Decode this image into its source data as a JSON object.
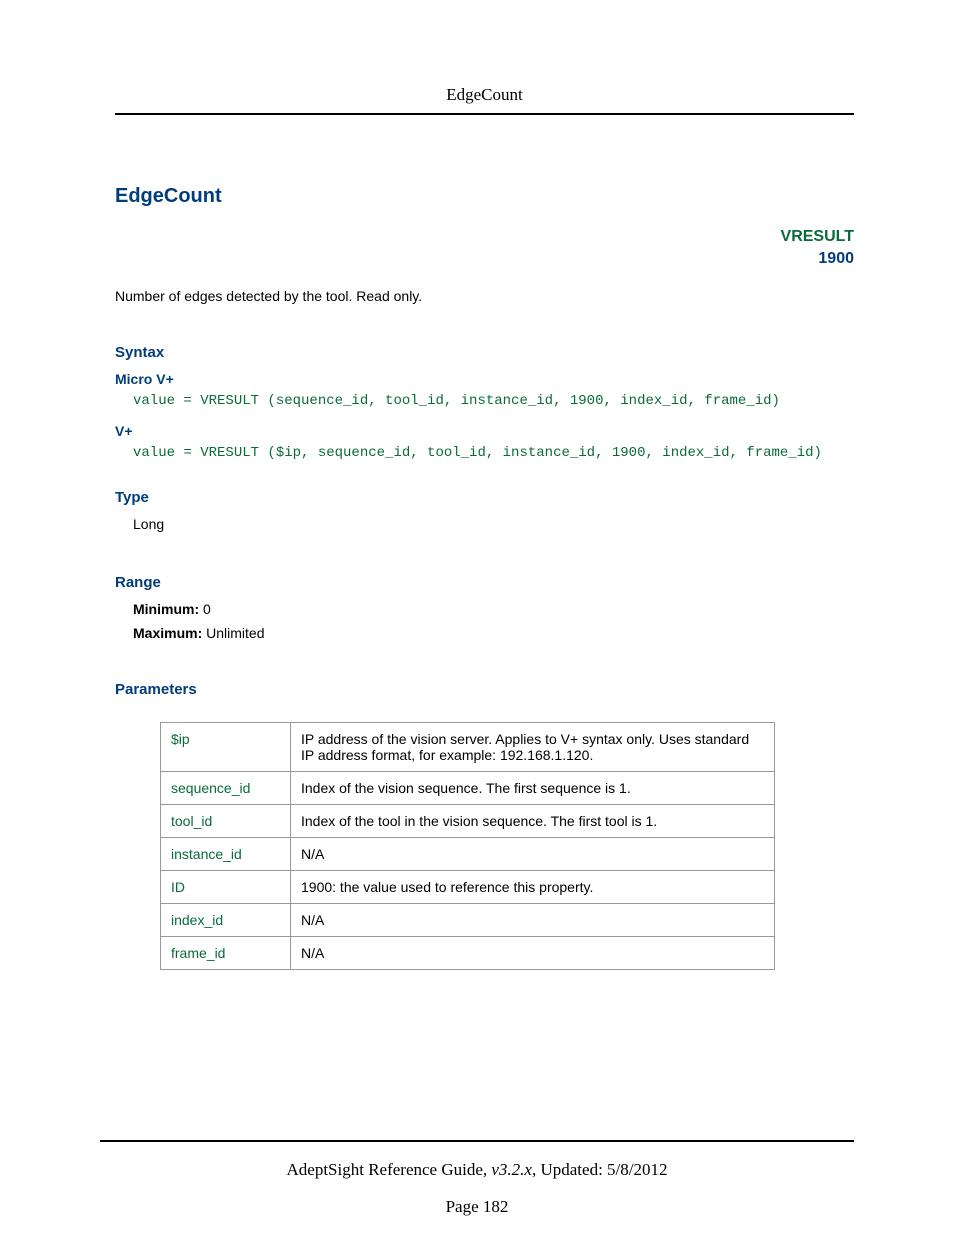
{
  "header": {
    "title": "EdgeCount"
  },
  "main": {
    "title": "EdgeCount",
    "badge": {
      "type": "VRESULT",
      "number": "1900"
    },
    "description": "Number of edges detected by the tool. Read only."
  },
  "syntax": {
    "heading": "Syntax",
    "micro_heading": "Micro V+",
    "micro_code": "value = VRESULT (sequence_id, tool_id, instance_id, 1900, index_id, frame_id)",
    "vplus_heading": "V+",
    "vplus_code": "value = VRESULT ($ip, sequence_id, tool_id, instance_id, 1900, index_id, frame_id)"
  },
  "type": {
    "heading": "Type",
    "value": "Long"
  },
  "range": {
    "heading": "Range",
    "min_label": "Minimum:",
    "min_value": " 0",
    "max_label": "Maximum:",
    "max_value": " Unlimited"
  },
  "parameters": {
    "heading": "Parameters",
    "rows": [
      {
        "name": "$ip",
        "desc": "IP address of the vision server. Applies to V+ syntax only. Uses standard IP address format, for example: 192.168.1.120."
      },
      {
        "name": "sequence_id",
        "desc": "Index of the vision sequence. The first sequence is 1."
      },
      {
        "name": "tool_id",
        "desc": "Index of the tool in the vision sequence. The first tool is 1."
      },
      {
        "name": "instance_id",
        "desc": "N/A"
      },
      {
        "name": "ID",
        "desc": "1900: the value used to reference this property."
      },
      {
        "name": "index_id",
        "desc": "N/A"
      },
      {
        "name": "frame_id",
        "desc": "N/A"
      }
    ]
  },
  "footer": {
    "guide": "AdeptSight Reference Guide",
    "version": ", v3.2.x",
    "updated": ", Updated: 5/8/2012",
    "page": "Page 182"
  }
}
